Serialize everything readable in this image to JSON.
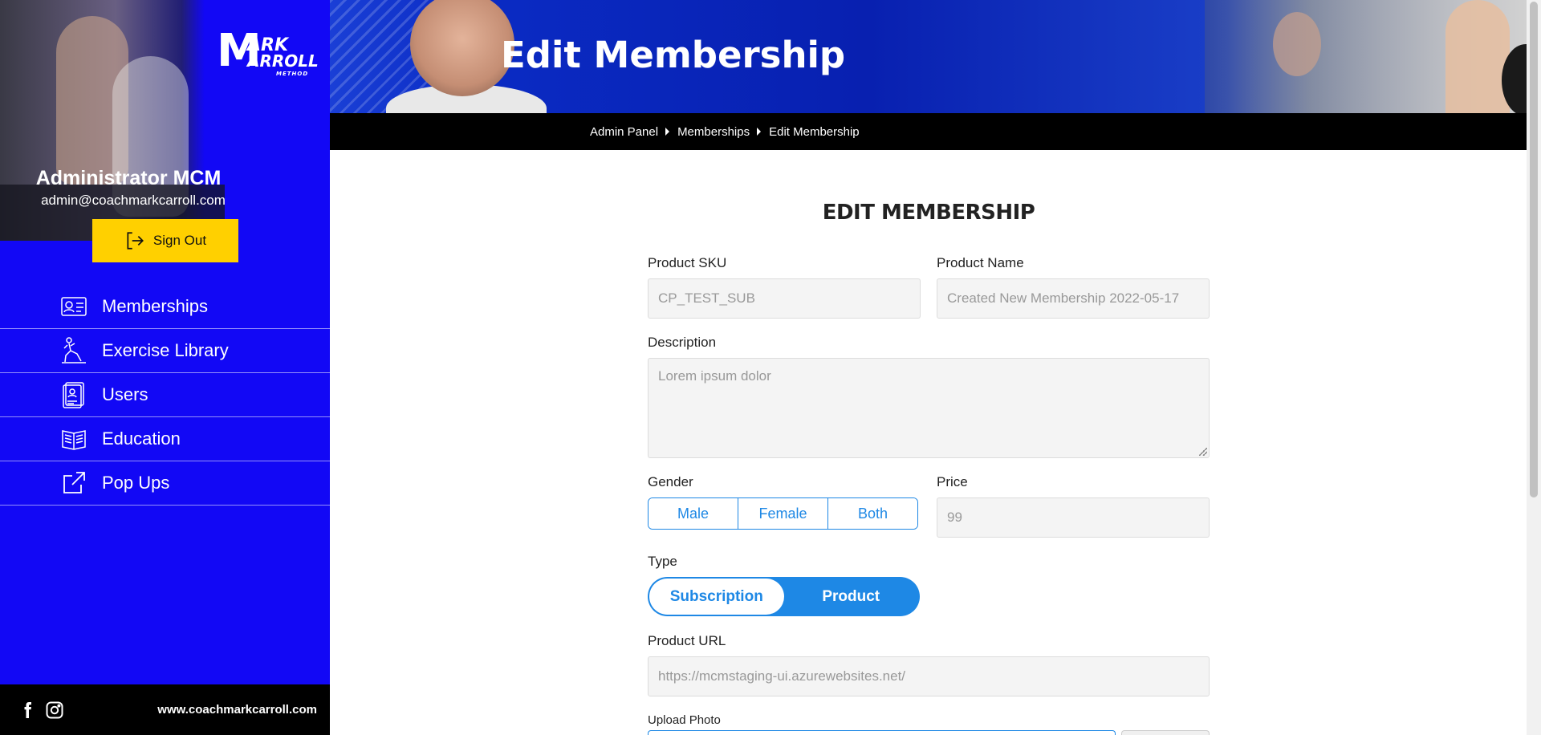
{
  "sidebar": {
    "logo": {
      "line1": "ARK",
      "line2": "ARROLL",
      "line3": "METHOD",
      "mark": "M"
    },
    "admin_name": "Administrator MCM",
    "admin_email": "admin@coachmarkcarroll.com",
    "signout_label": "Sign Out",
    "nav": [
      {
        "label": "Memberships",
        "icon": "membership-card-icon"
      },
      {
        "label": "Exercise Library",
        "icon": "exercise-lunge-icon"
      },
      {
        "label": "Users",
        "icon": "user-document-icon"
      },
      {
        "label": "Education",
        "icon": "open-book-icon"
      },
      {
        "label": "Pop Ups",
        "icon": "external-link-icon"
      }
    ],
    "footer": {
      "social": [
        "facebook-icon",
        "instagram-icon"
      ],
      "url": "www.coachmarkcarroll.com"
    },
    "accent_color": "#1208f5"
  },
  "header": {
    "title": "Edit Membership",
    "breadcrumb": [
      "Admin Panel",
      "Memberships",
      "Edit Membership"
    ]
  },
  "form": {
    "title": "Edit Membership",
    "sku": {
      "label": "Product SKU",
      "value": "CP_TEST_SUB"
    },
    "name": {
      "label": "Product Name",
      "value": "Created New Membership 2022-05-17"
    },
    "description": {
      "label": "Description",
      "value": "Lorem ipsum dolor"
    },
    "gender": {
      "label": "Gender",
      "options": [
        "Male",
        "Female",
        "Both"
      ]
    },
    "price": {
      "label": "Price",
      "value": "99"
    },
    "type": {
      "label": "Type",
      "options": [
        "Subscription",
        "Product"
      ],
      "selected": "Subscription"
    },
    "url": {
      "label": "Product URL",
      "value": "https://mcmstaging-ui.azurewebsites.net/"
    },
    "upload": {
      "label": "Upload Photo"
    },
    "accent_color": "#1e88e5",
    "signout_color": "#ffd000"
  }
}
